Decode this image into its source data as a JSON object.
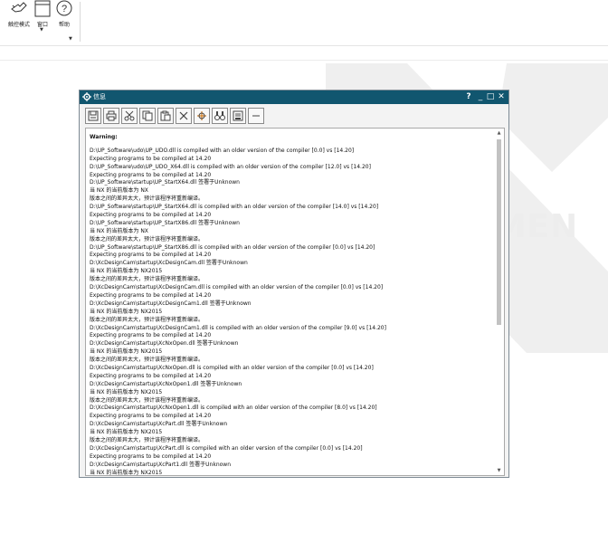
{
  "ribbon": {
    "touch_mode_label": "触控模式",
    "window_label": "窗口",
    "help_label": "帮助"
  },
  "watermark": {
    "text": "EMEN"
  },
  "dialog": {
    "title": "信息",
    "controls": {
      "help": "?",
      "minimize": "_",
      "maximize": "□",
      "close": "✕"
    },
    "toolbar_icons": [
      "save-icon",
      "print-icon",
      "cut-icon",
      "copy-icon",
      "paste-icon",
      "delete-icon",
      "find-icon",
      "binoculars-icon",
      "document-icon",
      "minus-icon"
    ],
    "heading": "Warning:",
    "lines": [
      "D:\\UP_Software\\udo\\UP_UDO.dll is compiled with an older version of the compiler [0.0] vs [14.20]",
      "Expecting programs to be compiled at 14.20",
      "D:\\UP_Software\\udo\\UP_UDO_X64.dll is compiled with an older version of the compiler [12.0] vs [14.20]",
      "Expecting programs to be compiled at 14.20",
      "D:\\UP_Software\\startup\\UP_StartX64.dll 签署于Unknown",
      "当 NX 的当前版本为 NX",
      "版本之间的差异太大，预计该程序将重新编译。",
      "D:\\UP_Software\\startup\\UP_StartX64.dll is compiled with an older version of the compiler [14.0] vs [14.20]",
      "Expecting programs to be compiled at 14.20",
      "D:\\UP_Software\\startup\\UP_StartX86.dll 签署于Unknown",
      "当 NX 的当前版本为 NX",
      "版本之间的差异太大，预计该程序将重新编译。",
      "D:\\UP_Software\\startup\\UP_StartX86.dll is compiled with an older version of the compiler [0.0] vs [14.20]",
      "Expecting programs to be compiled at 14.20",
      "D:\\XcDesignCam\\startup\\XcDesignCam.dll 签署于Unknown",
      "当 NX 的当前版本为 NX2015",
      "版本之间的差异太大，预计该程序将重新编译。",
      "D:\\XcDesignCam\\startup\\XcDesignCam.dll is compiled with an older version of the compiler [0.0] vs [14.20]",
      "Expecting programs to be compiled at 14.20",
      "D:\\XcDesignCam\\startup\\XcDesignCam1.dll 签署于Unknown",
      "当 NX 的当前版本为 NX2015",
      "版本之间的差异太大，预计该程序将重新编译。",
      "D:\\XcDesignCam\\startup\\XcDesignCam1.dll is compiled with an older version of the compiler [9.0] vs [14.20]",
      "Expecting programs to be compiled at 14.20",
      "D:\\XcDesignCam\\startup\\XcNxOpen.dll 签署于Unknown",
      "当 NX 的当前版本为 NX2015",
      "版本之间的差异太大，预计该程序将重新编译。",
      "D:\\XcDesignCam\\startup\\XcNxOpen.dll is compiled with an older version of the compiler [0.0] vs [14.20]",
      "Expecting programs to be compiled at 14.20",
      "D:\\XcDesignCam\\startup\\XcNxOpen1.dll 签署于Unknown",
      "当 NX 的当前版本为 NX2015",
      "版本之间的差异太大，预计该程序将重新编译。",
      "D:\\XcDesignCam\\startup\\XcNxOpen1.dll is compiled with an older version of the compiler [8.0] vs [14.20]",
      "Expecting programs to be compiled at 14.20",
      "D:\\XcDesignCam\\startup\\XcPart.dll 签署于Unknown",
      "当 NX 的当前版本为 NX2015",
      "版本之间的差异太大，预计该程序将重新编译。",
      "D:\\XcDesignCam\\startup\\XcPart.dll is compiled with an older version of the compiler [0.0] vs [14.20]",
      "Expecting programs to be compiled at 14.20",
      "D:\\XcDesignCam\\startup\\XcPart1.dll 签署于Unknown",
      "当 NX 的当前版本为 NX2015"
    ]
  }
}
